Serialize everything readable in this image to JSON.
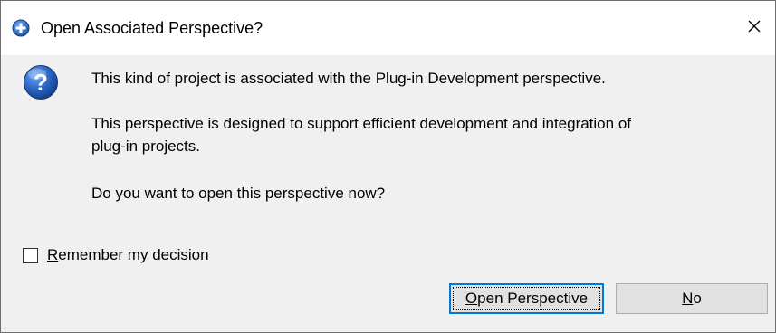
{
  "window": {
    "title": "Open Associated Perspective?",
    "title_icon": "eclipse-plus-icon",
    "close_glyph": "✕"
  },
  "message": {
    "icon": "question-icon",
    "line1": "This kind of project is associated with the Plug-in Development perspective.",
    "line2a": "This perspective is designed to support efficient development and integration of",
    "line2b": "plug-in projects.",
    "line3": "Do you want to open this perspective now?"
  },
  "remember": {
    "label": "Remember my decision",
    "checked": false
  },
  "buttons": {
    "open_label": "Open Perspective",
    "no_label": "No"
  },
  "colors": {
    "accent": "#0078d7",
    "question_icon_blue": "#1e5fb4",
    "background": "#f0f0f0"
  }
}
